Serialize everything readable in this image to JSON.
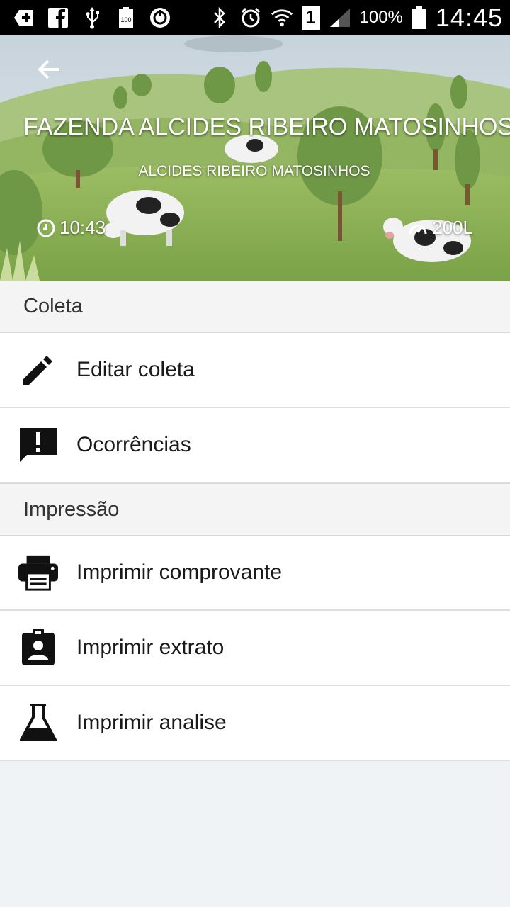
{
  "status_bar": {
    "battery_percent": "100%",
    "time": "14:45",
    "sim_slot": "1",
    "left_icons": [
      "add-icon",
      "facebook-icon",
      "usb-icon",
      "battery-100-icon",
      "sync-icon"
    ],
    "right_icons": [
      "bluetooth-icon",
      "alarm-icon",
      "wifi-icon",
      "signal-icon",
      "battery-icon"
    ]
  },
  "header": {
    "farm_name": "FAZENDA ALCIDES RIBEIRO MATOSINHOS",
    "owner_name": "ALCIDES RIBEIRO MATOSINHOS",
    "time": "10:43",
    "volume": "200L",
    "background": "cows-in-pasture-illustration"
  },
  "sections": [
    {
      "title": "Coleta",
      "items": [
        {
          "label": "Editar coleta",
          "icon": "pencil-icon"
        },
        {
          "label": "Ocorrências",
          "icon": "alert-message-icon"
        }
      ]
    },
    {
      "title": "Impressão",
      "items": [
        {
          "label": "Imprimir comprovante",
          "icon": "printer-icon"
        },
        {
          "label": "Imprimir extrato",
          "icon": "contact-badge-icon"
        },
        {
          "label": "Imprimir analise",
          "icon": "flask-icon"
        }
      ]
    }
  ],
  "colors": {
    "status_bar": "#000000",
    "section_header_bg": "#f4f4f4",
    "page_bg": "#f0f3f6",
    "item_text": "#1a1a1a"
  }
}
